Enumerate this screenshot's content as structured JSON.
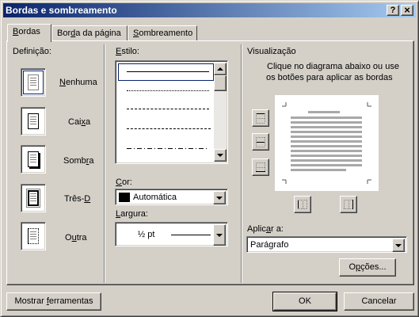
{
  "window": {
    "title": "Bordas e sombreamento",
    "help_button": "?",
    "close_button": "×"
  },
  "tabs": [
    {
      "label_pre": "",
      "accel": "B",
      "label_post": "ordas",
      "active": true
    },
    {
      "label_pre": "Bor",
      "accel": "d",
      "label_post": "a da página",
      "active": false
    },
    {
      "label_pre": "",
      "accel": "S",
      "label_post": "ombreamento",
      "active": false
    }
  ],
  "definition": {
    "label_pre": "Definição:",
    "items": [
      {
        "pre": "",
        "accel": "N",
        "post": "enhuma"
      },
      {
        "pre": "Cai",
        "accel": "x",
        "post": "a"
      },
      {
        "pre": "Somb",
        "accel": "r",
        "post": "a"
      },
      {
        "pre": "Três-",
        "accel": "D",
        "post": ""
      },
      {
        "pre": "O",
        "accel": "u",
        "post": "tra"
      }
    ]
  },
  "style": {
    "label_pre": "",
    "label_accel": "E",
    "label_post": "stilo:",
    "selected_index": 0
  },
  "color": {
    "label_pre": "",
    "label_accel": "C",
    "label_post": "or:",
    "value": "Automática",
    "swatch": "#000000"
  },
  "width": {
    "label_pre": "",
    "label_accel": "L",
    "label_post": "argura:",
    "value": "½ pt"
  },
  "preview": {
    "label": "Visualização",
    "hint_line1": "Clique no diagrama abaixo ou use",
    "hint_line2": "os botões para aplicar as bordas"
  },
  "apply_to": {
    "label_pre": "Aplic",
    "label_accel": "a",
    "label_post": "r a:",
    "value": "Parágrafo"
  },
  "buttons": {
    "options_pre": "O",
    "options_accel": "p",
    "options_post": "ções...",
    "toolbar_pre": "Mostrar ",
    "toolbar_accel": "f",
    "toolbar_post": "erramentas",
    "ok": "OK",
    "cancel": "Cancelar"
  },
  "colors": {
    "title_start": "#0a246a",
    "title_end": "#a6caf0",
    "face": "#d4d0c8",
    "selection": "#0a246a"
  }
}
